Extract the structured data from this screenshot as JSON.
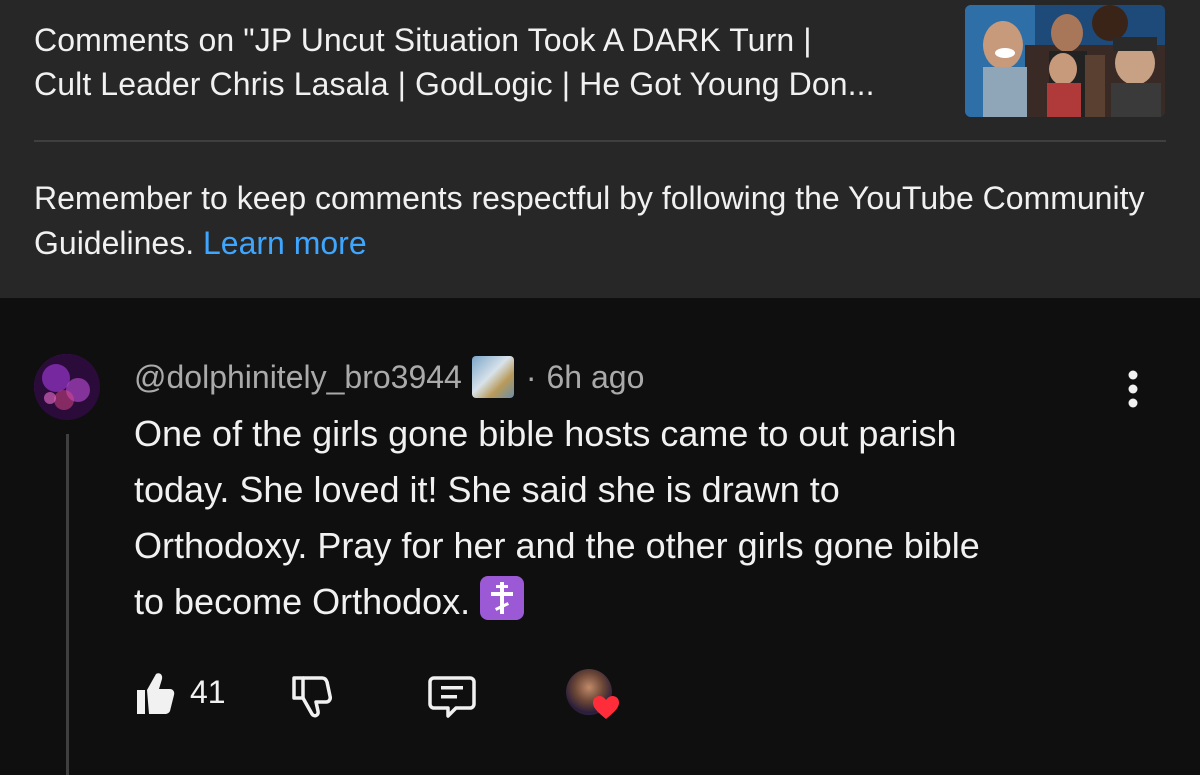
{
  "header": {
    "title_line1": "Comments on \"JP Uncut Situation Took A DARK Turn |",
    "title_line2": "Cult Leader Chris Lasala | GodLogic | He Got Young Don..."
  },
  "guidelines": {
    "text": "Remember to keep comments respectful by following the YouTube Community Guidelines.",
    "link_label": "Learn more"
  },
  "comment": {
    "author": "@dolphinitely_bro3944",
    "separator": "·",
    "timestamp": "6h ago",
    "text_lines": [
      "One of the girls gone bible hosts came to out parish",
      "today. She loved it! She said she is drawn to",
      "Orthodoxy. Pray for her and the other girls gone bible",
      "to become Orthodox."
    ],
    "emoji": "orthodox-cross-emoji",
    "like_count": "41"
  },
  "colors": {
    "background": "#0f0f0f",
    "panel": "#272727",
    "link": "#3ea6ff",
    "secondary_text": "#aaaaaa",
    "heart": "#ff2d3a",
    "emoji_bg": "#9b59d6"
  }
}
